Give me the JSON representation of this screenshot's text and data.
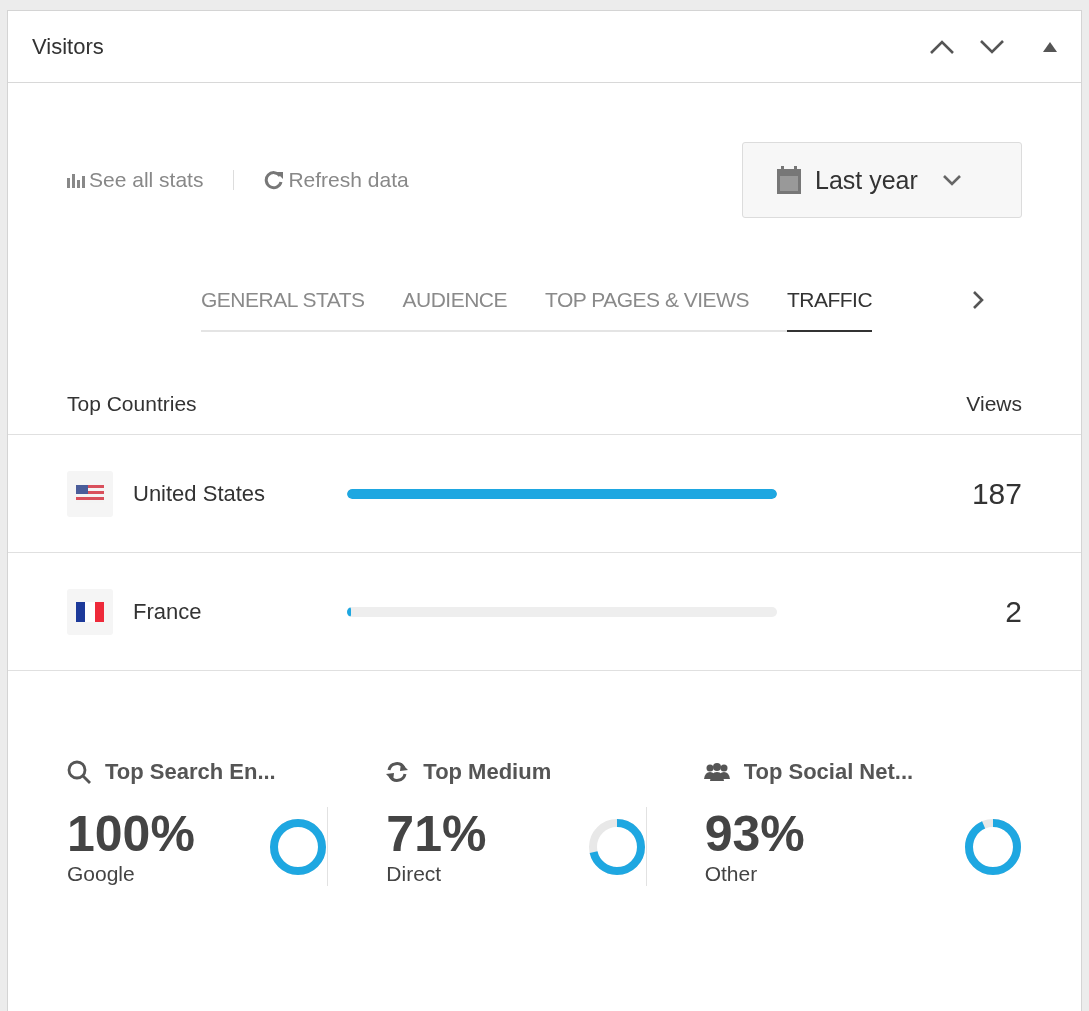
{
  "panel": {
    "title": "Visitors"
  },
  "toolbar": {
    "links": [
      {
        "kind": "stats",
        "label": "See all stats"
      },
      {
        "kind": "refresh",
        "label": "Refresh data"
      }
    ],
    "range": {
      "label": "Last year"
    }
  },
  "tabs": [
    {
      "label": "GENERAL STATS",
      "selected": false
    },
    {
      "label": "AUDIENCE",
      "selected": false
    },
    {
      "label": "TOP PAGES & VIEWS",
      "selected": false
    },
    {
      "label": "TRAFFIC",
      "selected": true
    }
  ],
  "countries": {
    "heading": "Top Countries",
    "views_heading": "Views",
    "rows": [
      {
        "kind": "us",
        "name": "United States",
        "level": 1.0,
        "views": "187"
      },
      {
        "kind": "fr",
        "name": "France",
        "level": 0.01,
        "views": "2"
      }
    ]
  },
  "summaries": [
    {
      "kind": "search",
      "title": "Top Search En...",
      "percent": "100%",
      "source": "Google"
    },
    {
      "kind": "medium",
      "title": "Top Medium",
      "percent": "71%",
      "source": "Direct"
    },
    {
      "kind": "social",
      "title": "Top Social Net...",
      "percent": "93%",
      "source": "Other"
    }
  ]
}
